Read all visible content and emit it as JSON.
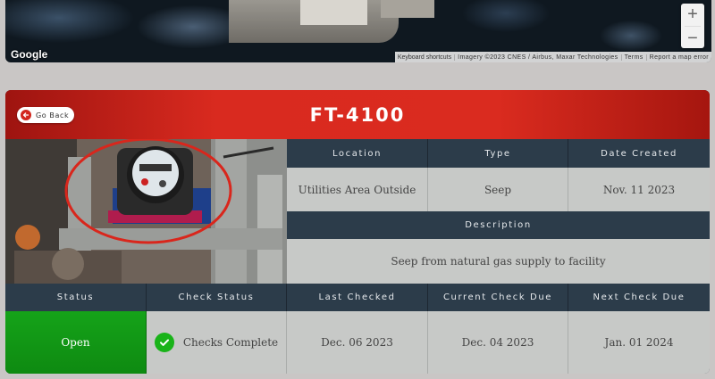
{
  "map": {
    "logo": "Google",
    "zoom_in": "+",
    "zoom_out": "−",
    "attribution": {
      "shortcuts": "Keyboard shortcuts",
      "imagery": "Imagery ©2023 CNES / Airbus, Maxar Technologies",
      "terms": "Terms",
      "report": "Report a map error"
    }
  },
  "header": {
    "back_label": "Go Back",
    "back_icon": "arrow-left-circle-icon",
    "title": "FT-4100",
    "accent_color": "#d92a1f"
  },
  "details": {
    "location_label": "Location",
    "location_value": "Utilities Area Outside",
    "type_label": "Type",
    "type_value": "Seep",
    "date_created_label": "Date Created",
    "date_created_value": "Nov. 11 2023",
    "description_label": "Description",
    "description_value": "Seep from natural gas supply to facility"
  },
  "status_row": {
    "status_label": "Status",
    "status_value": "Open",
    "status_color": "#15a319",
    "check_status_label": "Check Status",
    "check_status_value": "Checks Complete",
    "check_icon": "check-circle-icon",
    "last_checked_label": "Last Checked",
    "last_checked_value": "Dec. 06 2023",
    "current_due_label": "Current Check Due",
    "current_due_value": "Dec. 04 2023",
    "next_due_label": "Next Check Due",
    "next_due_value": "Jan. 01 2024"
  }
}
